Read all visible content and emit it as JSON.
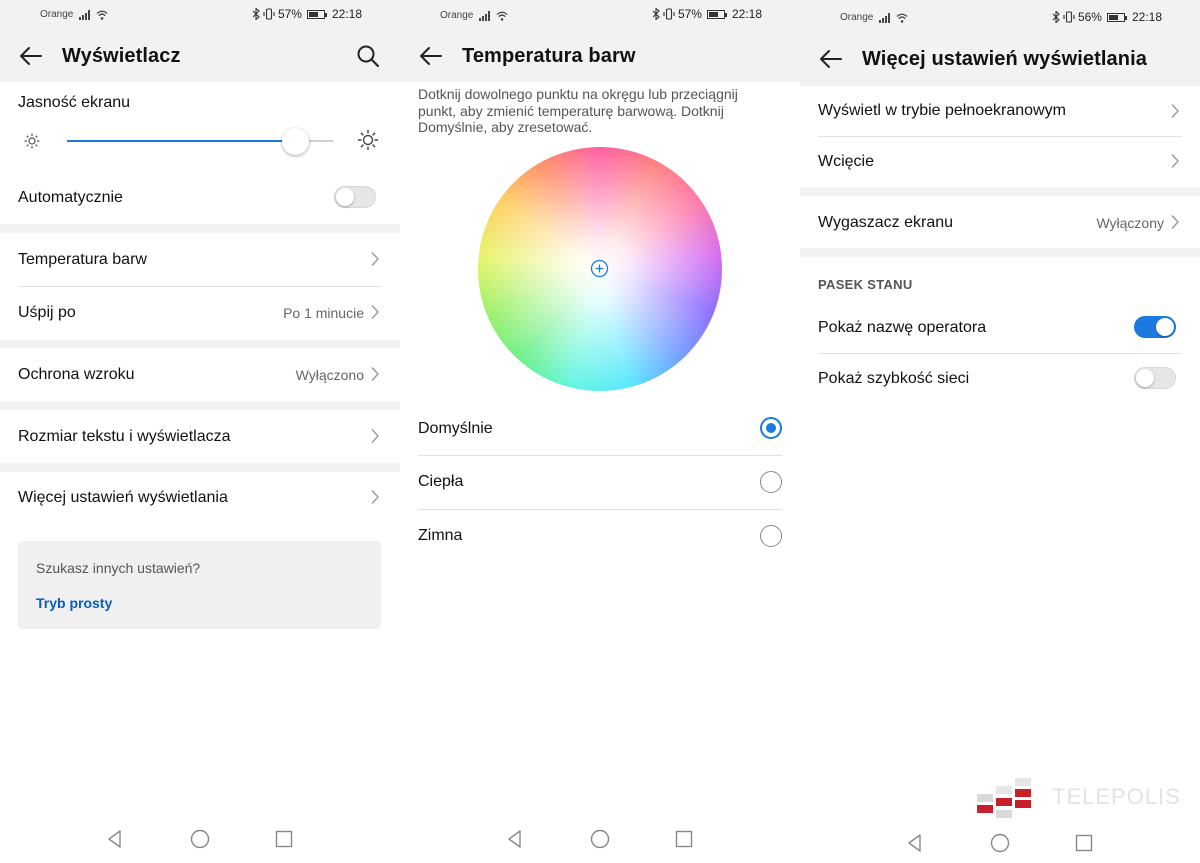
{
  "panel1": {
    "status": {
      "carrier": "Orange",
      "battery": "57%",
      "time": "22:18"
    },
    "title": "Wyświetlacz",
    "brightness": {
      "label": "Jasność ekranu",
      "level": 0.9
    },
    "auto": {
      "label": "Automatycznie",
      "on": false
    },
    "items": [
      {
        "label": "Temperatura barw",
        "value": ""
      },
      {
        "label": "Uśpij po",
        "value": "Po 1 minucie"
      },
      {
        "label": "Ochrona wzroku",
        "value": "Wyłączono"
      },
      {
        "label": "Rozmiar tekstu i wyświetlacza",
        "value": ""
      },
      {
        "label": "Więcej ustawień wyświetlania",
        "value": ""
      }
    ],
    "tip": {
      "question": "Szukasz innych ustawień?",
      "link": "Tryb prosty"
    }
  },
  "panel2": {
    "status": {
      "carrier": "Orange",
      "battery": "57%",
      "time": "22:18"
    },
    "title": "Temperatura barw",
    "description": "Dotknij dowolnego punktu na okręgu lub przeciągnij punkt, aby zmienić temperaturę barwową. Dotknij Domyślnie, aby zresetować.",
    "options": [
      {
        "label": "Domyślnie",
        "selected": true
      },
      {
        "label": "Ciepła",
        "selected": false
      },
      {
        "label": "Zimna",
        "selected": false
      }
    ]
  },
  "panel3": {
    "status": {
      "carrier": "Orange",
      "battery": "56%",
      "time": "22:18"
    },
    "title": "Więcej ustawień wyświetlania",
    "items": [
      {
        "label": "Wyświetl w trybie pełnoekranowym",
        "value": ""
      },
      {
        "label": "Wcięcie",
        "value": ""
      },
      {
        "label": "Wygaszacz ekranu",
        "value": "Wyłączony"
      }
    ],
    "section": "PASEK STANU",
    "toggles": [
      {
        "label": "Pokaż nazwę operatora",
        "on": true
      },
      {
        "label": "Pokaż szybkość sieci",
        "on": false
      }
    ]
  },
  "watermark": "TELEPOLIS",
  "colors": {
    "accent": "#1a7ae0",
    "link": "#0a5bbf",
    "section_bg": "#f2f2f2"
  },
  "icons": [
    "back-arrow-icon",
    "search-icon",
    "sun-small-icon",
    "sun-large-icon",
    "chevron-right-icon",
    "nav-back-icon",
    "nav-home-icon",
    "nav-recents-icon",
    "bluetooth-icon",
    "vibrate-icon",
    "wifi-icon",
    "signal-icon",
    "battery-icon"
  ]
}
